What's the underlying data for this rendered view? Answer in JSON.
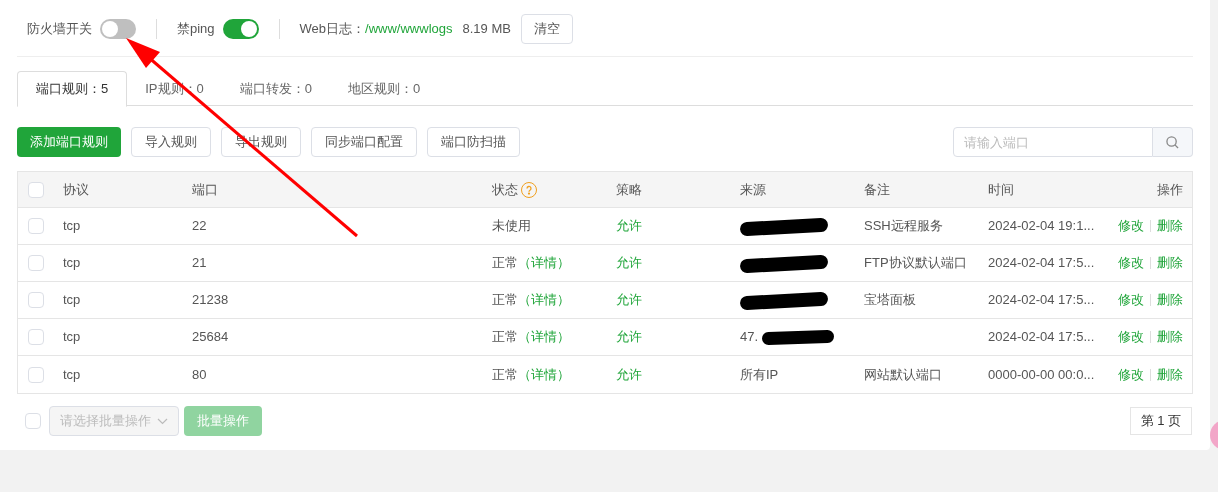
{
  "top_bar": {
    "firewall": {
      "label": "防火墙开关",
      "on": false
    },
    "ping": {
      "label": "禁ping",
      "on": true
    },
    "web_log": {
      "label": "Web日志：",
      "path": "/www/wwwlogs",
      "size": "8.19 MB",
      "clear_button": "清空"
    }
  },
  "tabs": [
    {
      "label": "端口规则：5",
      "selected": true
    },
    {
      "label": "IP规则：0",
      "selected": false
    },
    {
      "label": "端口转发：0",
      "selected": false
    },
    {
      "label": "地区规则：0",
      "selected": false
    }
  ],
  "toolbar": {
    "buttons": [
      {
        "label": "添加端口规则",
        "kind": "primary"
      },
      {
        "label": "导入规则",
        "kind": "default"
      },
      {
        "label": "导出规则",
        "kind": "default"
      },
      {
        "label": "同步端口配置",
        "kind": "default"
      },
      {
        "label": "端口防扫描",
        "kind": "default"
      }
    ],
    "search": {
      "placeholder": "请输入端口"
    }
  },
  "table": {
    "select_all_checked": false,
    "columns": [
      "协议",
      "端口",
      "状态",
      "策略",
      "来源",
      "备注",
      "时间",
      "操作"
    ],
    "rows": [
      {
        "checked": false,
        "protocol": "tcp",
        "port": "22",
        "status": "未使用",
        "status_detail": null,
        "policy": "允许",
        "source": null,
        "source_redacted": true,
        "note": "SSH远程服务",
        "time": "2024-02-04 19:1...",
        "actions": [
          "修改",
          "删除"
        ]
      },
      {
        "checked": false,
        "protocol": "tcp",
        "port": "21",
        "status": "正常",
        "status_detail": "（详情）",
        "policy": "允许",
        "source": null,
        "source_redacted": true,
        "note": "FTP协议默认端口",
        "time": "2024-02-04 17:5...",
        "actions": [
          "修改",
          "删除"
        ]
      },
      {
        "checked": false,
        "protocol": "tcp",
        "port": "21238",
        "status": "正常",
        "status_detail": "（详情）",
        "policy": "允许",
        "source": null,
        "source_redacted": true,
        "note": "宝塔面板",
        "time": "2024-02-04 17:5...",
        "actions": [
          "修改",
          "删除"
        ]
      },
      {
        "checked": false,
        "protocol": "tcp",
        "port": "25684",
        "status": "正常",
        "status_detail": "（详情）",
        "policy": "允许",
        "source": "47.",
        "source_redacted": true,
        "note": null,
        "time": "2024-02-04 17:5...",
        "actions": [
          "修改",
          "删除"
        ]
      },
      {
        "checked": false,
        "protocol": "tcp",
        "port": "80",
        "status": "正常",
        "status_detail": "（详情）",
        "policy": "允许",
        "source": "所有IP",
        "source_redacted": false,
        "note": "网站默认端口",
        "time": "0000-00-00 00:0...",
        "actions": [
          "修改",
          "删除"
        ]
      }
    ]
  },
  "footer": {
    "select_all_checked": false,
    "batch_select": {
      "placeholder": "请选择批量操作"
    },
    "batch_button": "批量操作",
    "page": "第 1 页"
  },
  "annotation": {
    "kind": "arrow"
  }
}
